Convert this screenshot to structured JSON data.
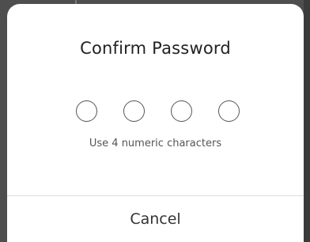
{
  "dialog": {
    "title": "Confirm Password",
    "pin_length": 4,
    "hint": "Use 4 numeric characters",
    "cancel_label": "Cancel"
  }
}
